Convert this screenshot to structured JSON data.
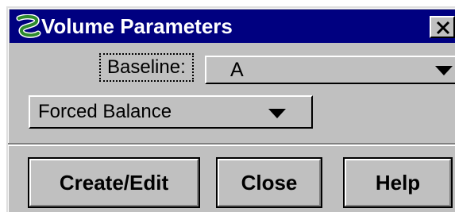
{
  "window": {
    "title": "Volume Parameters",
    "app_icon": "green-s-logo-icon",
    "close_icon": "close-icon"
  },
  "baseline": {
    "label": "Baseline:",
    "value": "A"
  },
  "balance": {
    "value": "Forced Balance"
  },
  "buttons": {
    "create_edit": "Create/Edit",
    "close": "Close",
    "help": "Help"
  },
  "colors": {
    "title_bar": "#000080",
    "face": "#c0c0c0",
    "icon_green": "#2e8b2e"
  }
}
